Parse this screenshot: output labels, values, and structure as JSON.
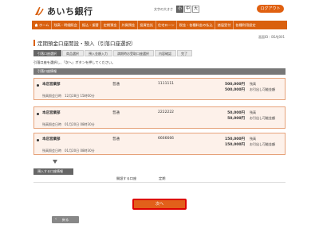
{
  "header": {
    "bank_name": "あいち銀行",
    "font_size_label": "文字の大きさ",
    "font_sizes": [
      "小",
      "中",
      "大"
    ],
    "logout_label": "ログアウト"
  },
  "nav": {
    "items": [
      "ホーム",
      "残高・明細照会",
      "振込・振替",
      "定期預金",
      "外貨預金",
      "投資信託",
      "住宅ローン",
      "税金・各種料金の払込",
      "諸届受付",
      "各種利用設定"
    ]
  },
  "page": {
    "id_label": "画面ID：BSAJ001",
    "title": "定期預金口座開設・預入（引落口座選択）",
    "steps": [
      "引落口座選択",
      "商品選択",
      "預入金額入力",
      "満期時お受取口座選択",
      "内容確認",
      "完了"
    ],
    "active_step": 0,
    "instruction": "引落口座を選択し、「次へ」ボタンを押してください。"
  },
  "from_section": {
    "header": "引落口座情報",
    "accounts": [
      {
        "branch": "本店営業部",
        "type": "普通",
        "number": "1111111",
        "balance": "500,000円",
        "available": "500,000円",
        "balance_label": "残高",
        "available_label": "お引出し可能金額",
        "date": "残高照会日時　12月28日 15時00分"
      },
      {
        "branch": "本店営業部",
        "type": "普通",
        "number": "2222222",
        "balance": "50,000円",
        "available": "50,000円",
        "balance_label": "残高",
        "available_label": "お引出し可能金額",
        "date": "残高照会日時　01月20日 08時30分"
      },
      {
        "branch": "本店営業部",
        "type": "普通",
        "number": "6666666",
        "balance": "150,000円",
        "available": "150,000円",
        "balance_label": "残高",
        "available_label": "お引出し可能金額",
        "date": "残高照会日時　01月20日 08時30分"
      }
    ]
  },
  "to_section": {
    "header": "預入する口座情報",
    "label": "開設する口座",
    "value": "定期"
  },
  "buttons": {
    "next": "次へ",
    "back": "戻る"
  }
}
